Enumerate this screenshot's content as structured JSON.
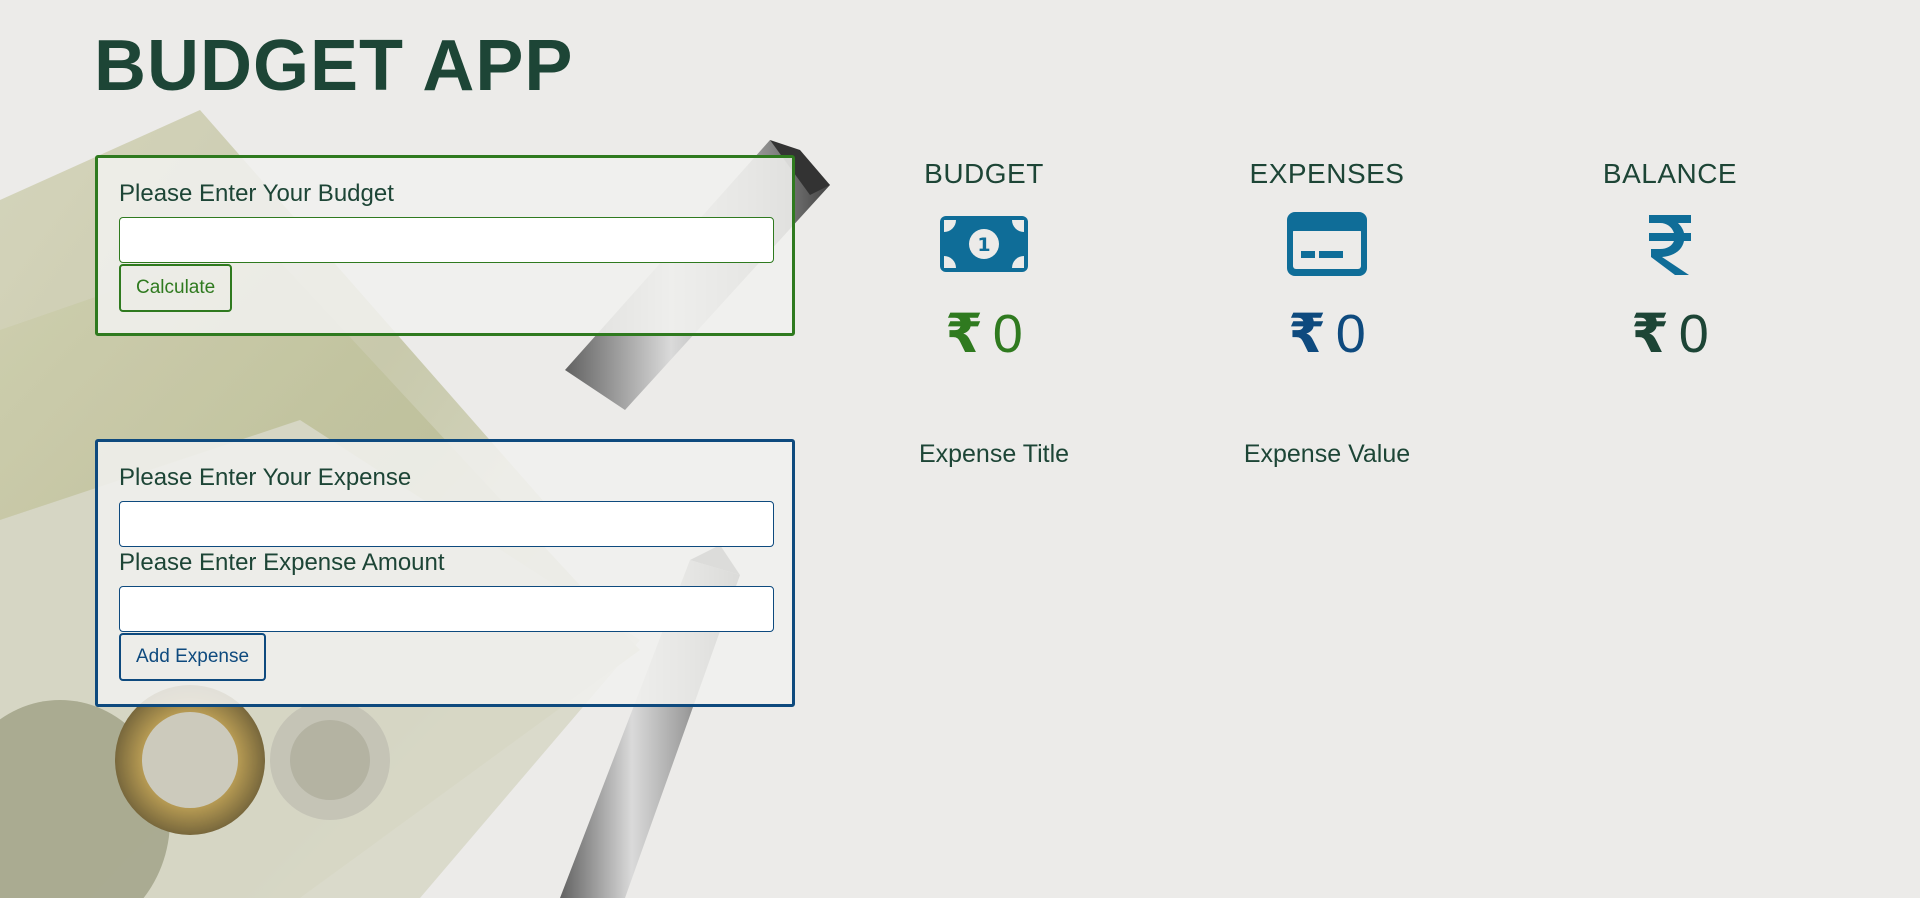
{
  "app": {
    "title": "BUDGET APP"
  },
  "budget_form": {
    "label": "Please Enter Your Budget",
    "input_value": "",
    "button_label": "Calculate"
  },
  "expense_form": {
    "title_label": "Please Enter Your Expense",
    "title_value": "",
    "amount_label": "Please Enter Expense Amount",
    "amount_value": "",
    "button_label": "Add Expense"
  },
  "summary": {
    "budget": {
      "title": "BUDGET",
      "currency": "₹",
      "amount": "0",
      "icon": "money-bill-icon"
    },
    "expenses": {
      "title": "EXPENSES",
      "currency": "₹",
      "amount": "0",
      "icon": "credit-card-icon"
    },
    "balance": {
      "title": "BALANCE",
      "currency": "₹",
      "amount": "0",
      "icon": "rupee-icon"
    }
  },
  "expense_list": {
    "headers": [
      "Expense Title",
      "Expense Value"
    ]
  },
  "colors": {
    "heading": "#1d4536",
    "budget_accent": "#2f7a1f",
    "expense_accent": "#0e4a7e",
    "icon": "#0f6d98",
    "background": "#ecebe9"
  }
}
